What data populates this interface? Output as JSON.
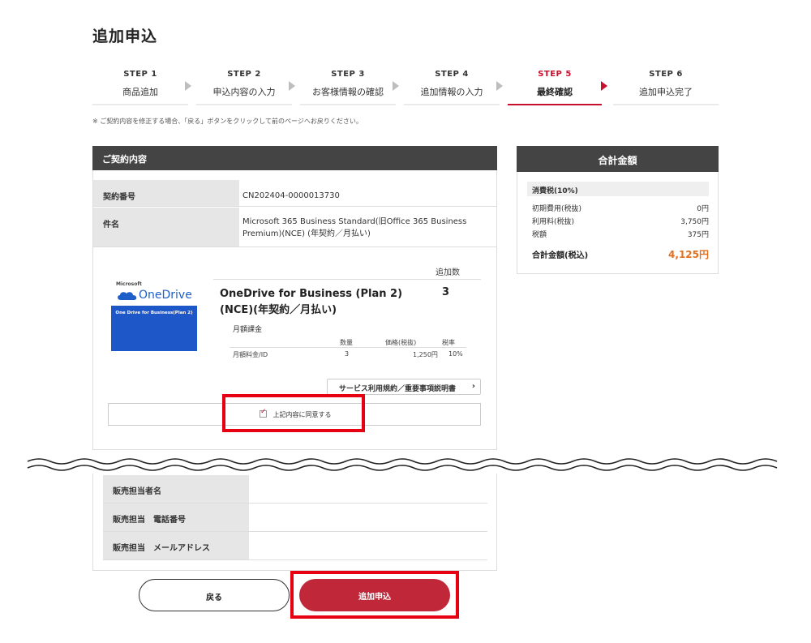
{
  "page": {
    "title": "追加申込"
  },
  "steps": [
    {
      "num": "STEP 1",
      "label": "商品追加"
    },
    {
      "num": "STEP 2",
      "label": "申込内容の入力"
    },
    {
      "num": "STEP 3",
      "label": "お客様情報の確認"
    },
    {
      "num": "STEP 4",
      "label": "追加情報の入力"
    },
    {
      "num": "STEP 5",
      "label": "最終確認"
    },
    {
      "num": "STEP 6",
      "label": "追加申込完了"
    }
  ],
  "active_step": 5,
  "notice": "※ ご契約内容を修正する場合、「戻る」ボタンをクリックして前のページへお戻りください。",
  "contract": {
    "heading": "ご契約内容",
    "rows": [
      {
        "key": "契約番号",
        "value": "CN202404-0000013730"
      },
      {
        "key": "件名",
        "value": "Microsoft 365 Business Standard(旧Office 365 Business Premium)(NCE) (年契約／月払い)"
      }
    ],
    "product": {
      "logo_brand": "Microsoft",
      "logo_name": "OneDrive",
      "logo_sub": "One Drive for Business(Plan 2)",
      "count_header": "追加数",
      "name": "OneDrive for Business (Plan 2)(NCE)(年契約／月払い)",
      "qty": "3",
      "billing_type": "月額課金",
      "table_headers": {
        "qty": "数量",
        "price": "価格(税抜)",
        "tax": "税率"
      },
      "table_row": {
        "item": "月額料金/ID",
        "qty": "3",
        "price": "1,250円",
        "tax": "10%"
      }
    },
    "terms_button": "サービス利用規約／重要事項説明書",
    "agree_label": "上記内容に同意する"
  },
  "summary": {
    "heading": "合計金額",
    "tax_label": "消費税(10%)",
    "rows": [
      {
        "label": "初期費用(税抜)",
        "value": "0円"
      },
      {
        "label": "利用料(税抜)",
        "value": "3,750円"
      },
      {
        "label": "税額",
        "value": "375円"
      }
    ],
    "total_label": "合計金額(税込)",
    "total_value": "4,125円"
  },
  "sales": {
    "rows": [
      {
        "key": "販売担当者名"
      },
      {
        "key": "販売担当　電話番号"
      },
      {
        "key": "販売担当　メールアドレス"
      }
    ]
  },
  "buttons": {
    "back": "戻る",
    "apply": "追加申込"
  },
  "colors": {
    "accent": "#c8102e",
    "apply": "#c0283a",
    "highlight": "#e60012",
    "total": "#e07020",
    "header": "#444444"
  }
}
